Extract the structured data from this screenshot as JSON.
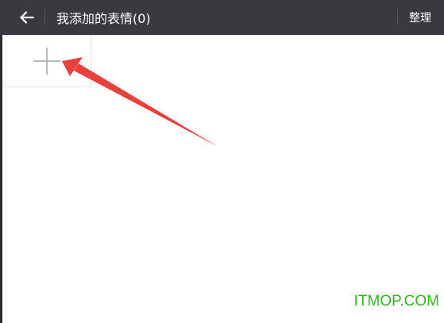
{
  "header": {
    "title": "我添加的表情(0)",
    "manage_label": "整理",
    "back_icon": "arrow-left-icon",
    "background": "#393a3f"
  },
  "content": {
    "add_tile_icon": "plus-icon",
    "annotation_color": "#e8413c"
  },
  "watermark": {
    "text": "ITMOP.COM",
    "color": "#2fb81f"
  }
}
